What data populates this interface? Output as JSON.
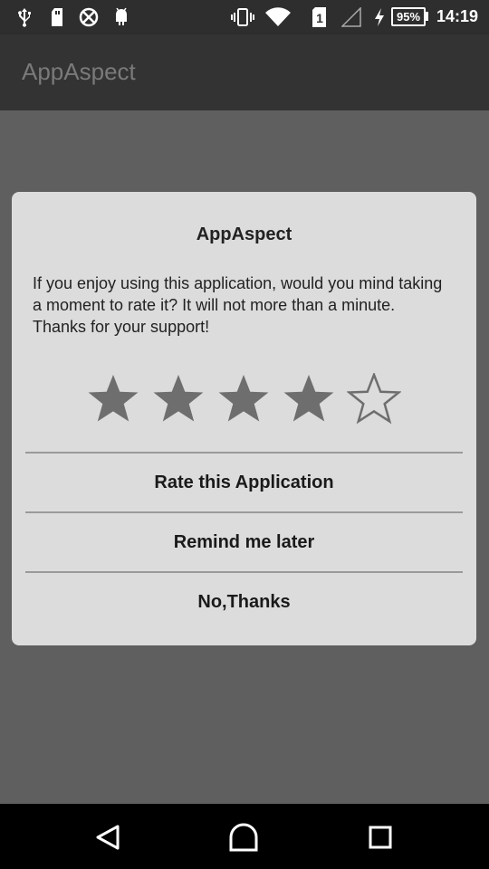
{
  "status_bar": {
    "battery_level": "95%",
    "time": "14:19",
    "sim_slot": "1",
    "icons": [
      "usb-icon",
      "sd-card-icon",
      "sync-disabled-icon",
      "android-debug-icon",
      "vibrate-icon",
      "wifi-icon",
      "sim-1-icon",
      "no-signal-icon",
      "charging-icon",
      "battery-icon"
    ]
  },
  "app_bar": {
    "title": "AppAspect"
  },
  "dialog": {
    "title": "AppAspect",
    "message": "If you enjoy using this application, would you mind taking a moment to rate it? It will not more than a minute. Thanks for your support!",
    "rating": {
      "value": 4,
      "max": 5
    },
    "buttons": {
      "rate": "Rate this Application",
      "remind": "Remind me later",
      "no_thanks": "No,Thanks"
    }
  },
  "nav_bar": {
    "icons": [
      "back-icon",
      "home-icon",
      "recents-icon"
    ]
  },
  "colors": {
    "status_bar": "#2e2e2e",
    "app_bar": "#333333",
    "background": "#5f5f5f",
    "dialog": "#dcdcdc",
    "star_filled": "#6e6e6e",
    "star_outline": "#6e6e6e",
    "divider": "#9a9a9a"
  }
}
